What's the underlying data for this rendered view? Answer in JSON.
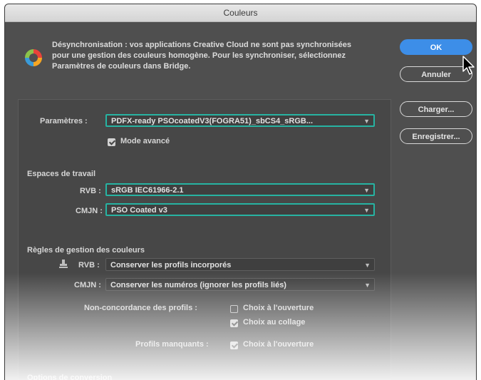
{
  "window": {
    "title": "Couleurs"
  },
  "sync_message": "Désynchronisation : vos applications Creative Cloud ne sont pas synchronisées pour une gestion des couleurs homogène. Pour les synchroniser, sélectionnez Paramètres de couleurs dans Bridge.",
  "settings": {
    "label": "Paramètres :",
    "value": "PDFX-ready PSOcoatedV3(FOGRA51)_sbCS4_sRGB...",
    "advanced_mode_label": "Mode avancé",
    "advanced_mode_checked": true
  },
  "working_spaces": {
    "title": "Espaces de travail",
    "rgb_label": "RVB :",
    "rgb_value": "sRGB IEC61966-2.1",
    "cmyk_label": "CMJN :",
    "cmyk_value": "PSO Coated v3"
  },
  "policies": {
    "title": "Règles de gestion des couleurs",
    "rgb_label": "RVB :",
    "rgb_value": "Conserver les profils incorporés",
    "cmyk_label": "CMJN :",
    "cmyk_value": "Conserver les numéros (ignorer les profils liés)",
    "mismatch_label": "Non-concordance des profils :",
    "mismatch_open_label": "Choix à l'ouverture",
    "mismatch_open_checked": false,
    "mismatch_paste_label": "Choix au collage",
    "mismatch_paste_checked": true,
    "missing_label": "Profils manquants :",
    "missing_open_label": "Choix à l'ouverture",
    "missing_open_checked": true
  },
  "conversion": {
    "title": "Options de conversion"
  },
  "buttons": {
    "ok": "OK",
    "cancel": "Annuler",
    "load": "Charger...",
    "save": "Enregistrer..."
  },
  "colors": {
    "highlight": "#27b3a2",
    "primary_button": "#3d8ee8",
    "dialog_bg": "#4f4f4f"
  },
  "icons": {
    "sync": "creative-cloud-sync-icon",
    "dropdown": "chevron-down-icon",
    "policy": "stamp-icon",
    "cursor": "mouse-pointer-icon"
  }
}
